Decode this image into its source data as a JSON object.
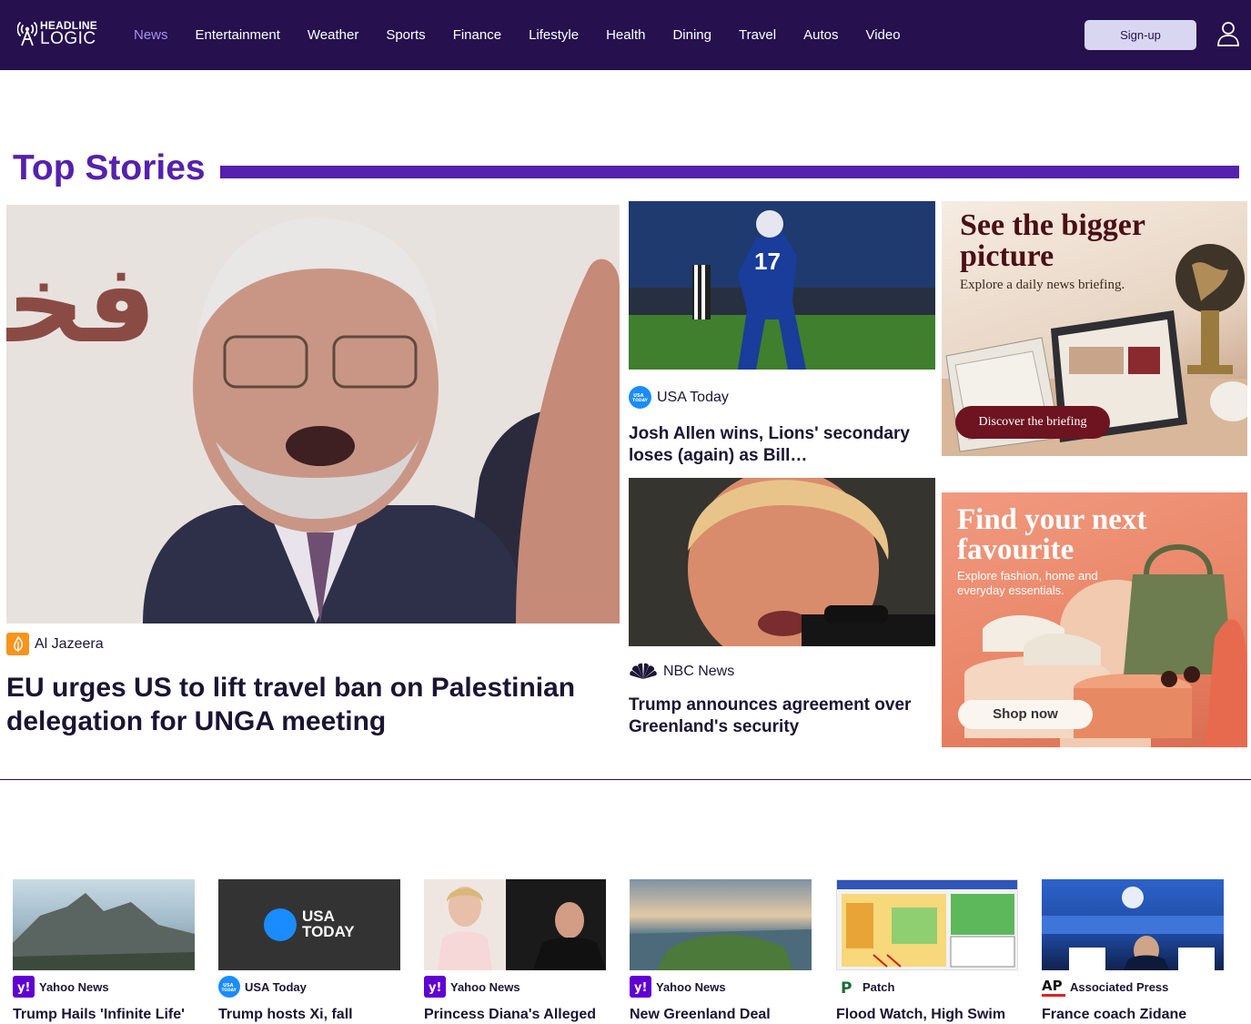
{
  "header": {
    "logo_line1": "HEADLINE",
    "logo_line2": "LOGIC",
    "nav": [
      "News",
      "Entertainment",
      "Weather",
      "Sports",
      "Finance",
      "Lifestyle",
      "Health",
      "Dining",
      "Travel",
      "Autos",
      "Video"
    ],
    "active_nav": "News",
    "signup_label": "Sign-up",
    "user_icon": "user-icon"
  },
  "section_title": "Top Stories",
  "lead": {
    "source": "Al Jazeera",
    "title": "EU urges US to lift travel ban on Palestinian delegation for UNGA meeting"
  },
  "middle": [
    {
      "source": "USA Today",
      "title": "Josh Allen wins, Lions' secondary loses (again) as Bill…"
    },
    {
      "source": "NBC News",
      "title": "Trump announces agreement over Greenland's security"
    }
  ],
  "ads": [
    {
      "heading": "See the bigger picture",
      "sub": "Explore a daily news briefing.",
      "button": "Discover the briefing"
    },
    {
      "heading": "Find your next favourite",
      "sub": "Explore fashion, home and everyday essentials.",
      "button": "Shop now"
    }
  ],
  "bottom": [
    {
      "source": "Yahoo News",
      "title": "Trump Hails 'Infinite Life'"
    },
    {
      "source": "USA Today",
      "title": "Trump hosts Xi, fall"
    },
    {
      "source": "Yahoo News",
      "title": "Princess Diana's Alleged"
    },
    {
      "source": "Yahoo News",
      "title": "New Greenland Deal"
    },
    {
      "source": "Patch",
      "title": "Flood Watch, High Swim"
    },
    {
      "source": "Associated Press",
      "title": "France coach Zidane"
    }
  ],
  "placeholder_logo_text": [
    "USA",
    "TODAY"
  ],
  "colors": {
    "header_bg": "#26104e",
    "accent": "#5521ad",
    "nav_active": "#a98ff0",
    "usa_today_blue": "#1a8cff",
    "yahoo_purple": "#6001d2",
    "al_jazeera_orange": "#f7941d"
  }
}
